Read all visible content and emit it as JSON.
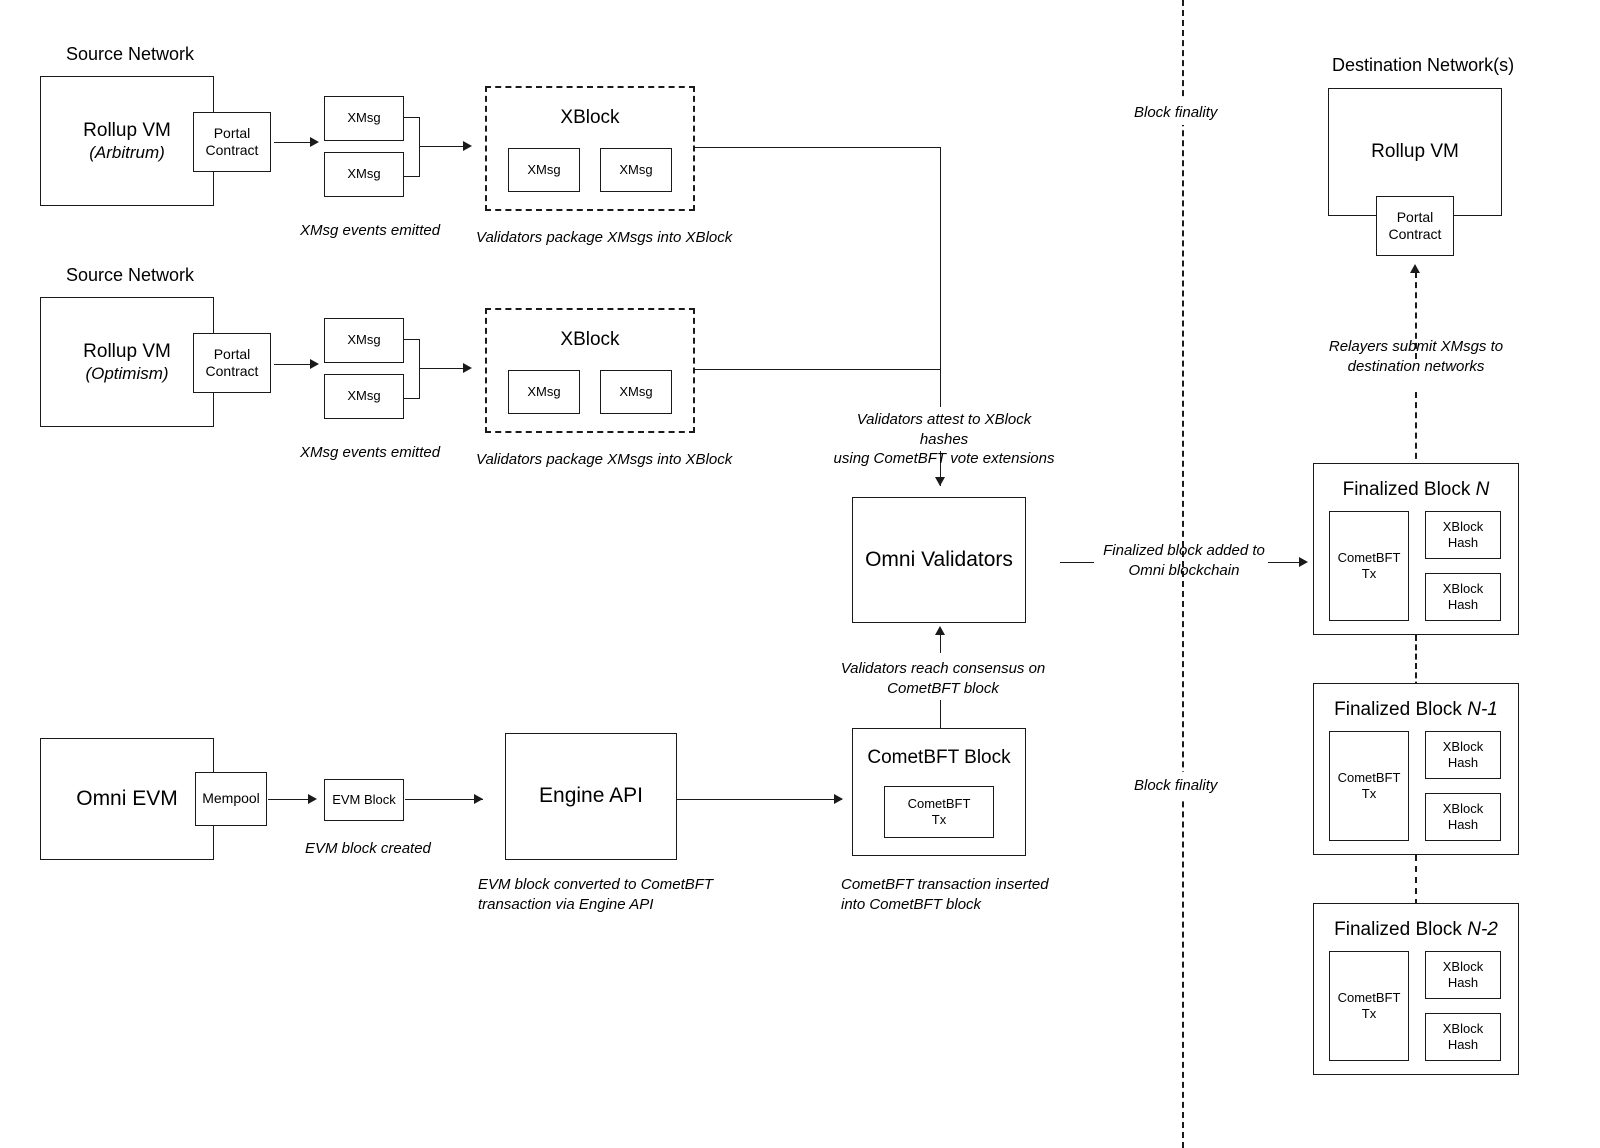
{
  "diagram": {
    "title": "Omni cross-chain message flow",
    "ink": "#1a1a1a",
    "background": "#ffffff"
  },
  "source_networks": [
    {
      "header": "Source Network",
      "rollup_vm": "Rollup VM",
      "rollup_vm_chain": "(Arbitrum)",
      "portal_contract": "Portal\nContract",
      "xmsg_a": "XMsg",
      "xmsg_b": "XMsg",
      "emit_note": "XMsg events emitted",
      "xblock_title": "XBlock",
      "xblock_msg_a": "XMsg",
      "xblock_msg_b": "XMsg",
      "package_note": "Validators package XMsgs into XBlock"
    },
    {
      "header": "Source Network",
      "rollup_vm": "Rollup VM",
      "rollup_vm_chain": "(Optimism)",
      "portal_contract": "Portal\nContract",
      "xmsg_a": "XMsg",
      "xmsg_b": "XMsg",
      "emit_note": "XMsg events emitted",
      "xblock_title": "XBlock",
      "xblock_msg_a": "XMsg",
      "xblock_msg_b": "XMsg",
      "package_note": "Validators package XMsgs into XBlock"
    }
  ],
  "omni_evm_flow": {
    "omni_evm": "Omni EVM",
    "mempool": "Mempool",
    "evm_block": "EVM Block",
    "evm_block_note": "EVM block created",
    "engine_api": "Engine API",
    "engine_api_note": "EVM block converted to CometBFT\ntransaction via Engine API",
    "cometbft_block": "CometBFT Block",
    "cometbft_tx": "CometBFT\nTx",
    "cometbft_block_note": "CometBFT transaction inserted\ninto CometBFT block"
  },
  "validators": {
    "attest_note": "Validators attest to XBlock hashes\nusing CometBFT vote extensions",
    "box_label": "Omni Validators",
    "consensus_note": "Validators reach consensus on\nCometBFT block",
    "finalized_note": "Finalized block added to\nOmni blockchain"
  },
  "finality_divider": {
    "label_top": "Block finality",
    "label_bottom": "Block finality"
  },
  "destination": {
    "header": "Destination Network(s)",
    "rollup_vm": "Rollup VM",
    "portal_contract": "Portal\nContract",
    "relayer_note": "Relayers submit XMsgs to\ndestination networks"
  },
  "finalized_blocks": [
    {
      "title_plain": "Finalized Block ",
      "title_italic": "N",
      "cometbft_tx": "CometBFT\nTx",
      "xblock_hash_a": "XBlock\nHash",
      "xblock_hash_b": "XBlock\nHash"
    },
    {
      "title_plain": "Finalized Block ",
      "title_italic": "N-1",
      "cometbft_tx": "CometBFT\nTx",
      "xblock_hash_a": "XBlock\nHash",
      "xblock_hash_b": "XBlock\nHash"
    },
    {
      "title_plain": "Finalized Block ",
      "title_italic": "N-2",
      "cometbft_tx": "CometBFT\nTx",
      "xblock_hash_a": "XBlock\nHash",
      "xblock_hash_b": "XBlock\nHash"
    }
  ]
}
